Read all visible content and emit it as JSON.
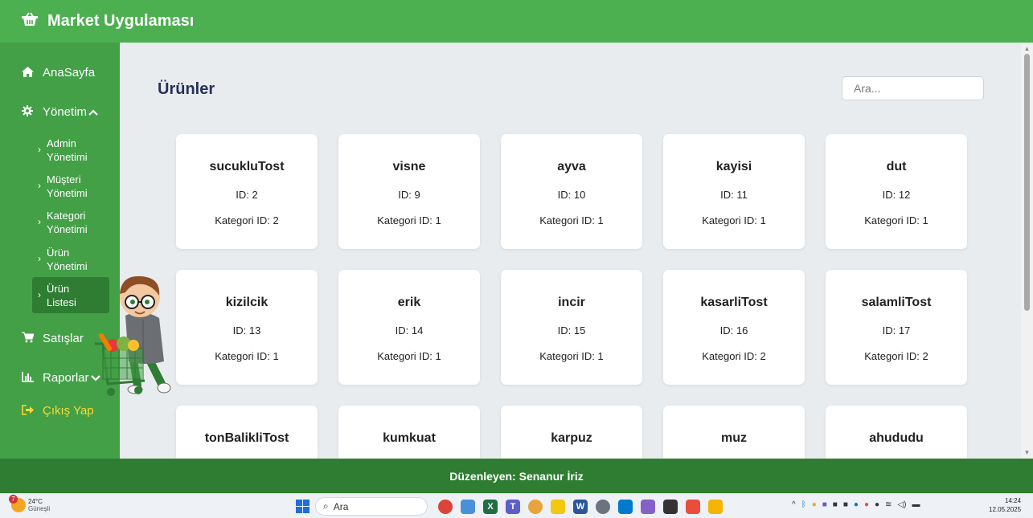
{
  "header": {
    "title": "Market Uygulaması"
  },
  "sidebar": {
    "items": [
      {
        "label": "AnaSayfa"
      },
      {
        "label": "Yönetim"
      },
      {
        "label": "Satışlar"
      },
      {
        "label": "Raporlar"
      },
      {
        "label": "Çıkış Yap"
      }
    ],
    "sub_items": [
      {
        "label1": "Admin",
        "label2": "Yönetimi"
      },
      {
        "label1": "Müşteri",
        "label2": "Yönetimi"
      },
      {
        "label1": "Kategori",
        "label2": "Yönetimi"
      },
      {
        "label1": "Ürün",
        "label2": "Yönetimi"
      },
      {
        "label1": "Ürün",
        "label2": "Listesi"
      }
    ]
  },
  "main": {
    "title": "Ürünler",
    "search_placeholder": "Ara...",
    "products": [
      {
        "name": "sucukluTost",
        "id": "ID: 2",
        "category": "Kategori ID: 2"
      },
      {
        "name": "visne",
        "id": "ID: 9",
        "category": "Kategori ID: 1"
      },
      {
        "name": "ayva",
        "id": "ID: 10",
        "category": "Kategori ID: 1"
      },
      {
        "name": "kayisi",
        "id": "ID: 11",
        "category": "Kategori ID: 1"
      },
      {
        "name": "dut",
        "id": "ID: 12",
        "category": "Kategori ID: 1"
      },
      {
        "name": "kizilcik",
        "id": "ID: 13",
        "category": "Kategori ID: 1"
      },
      {
        "name": "erik",
        "id": "ID: 14",
        "category": "Kategori ID: 1"
      },
      {
        "name": "incir",
        "id": "ID: 15",
        "category": "Kategori ID: 1"
      },
      {
        "name": "kasarliTost",
        "id": "ID: 16",
        "category": "Kategori ID: 2"
      },
      {
        "name": "salamliTost",
        "id": "ID: 17",
        "category": "Kategori ID: 2"
      },
      {
        "name": "tonBalikliTost"
      },
      {
        "name": "kumkuat"
      },
      {
        "name": "karpuz"
      },
      {
        "name": "muz"
      },
      {
        "name": "ahududu"
      }
    ]
  },
  "footer": {
    "text": "Düzenleyen: Senanur İriz"
  },
  "taskbar": {
    "weather_temp": "24°C",
    "weather_desc": "Güneşli",
    "weather_badge": "7",
    "search_label": "Ara",
    "time": "14:24",
    "date": "12.05.2025"
  },
  "colors": {
    "header": "#4caf50",
    "sidebar": "#43a047",
    "footer": "#2e7d32",
    "title": "#263159",
    "logout": "#fdd835"
  }
}
